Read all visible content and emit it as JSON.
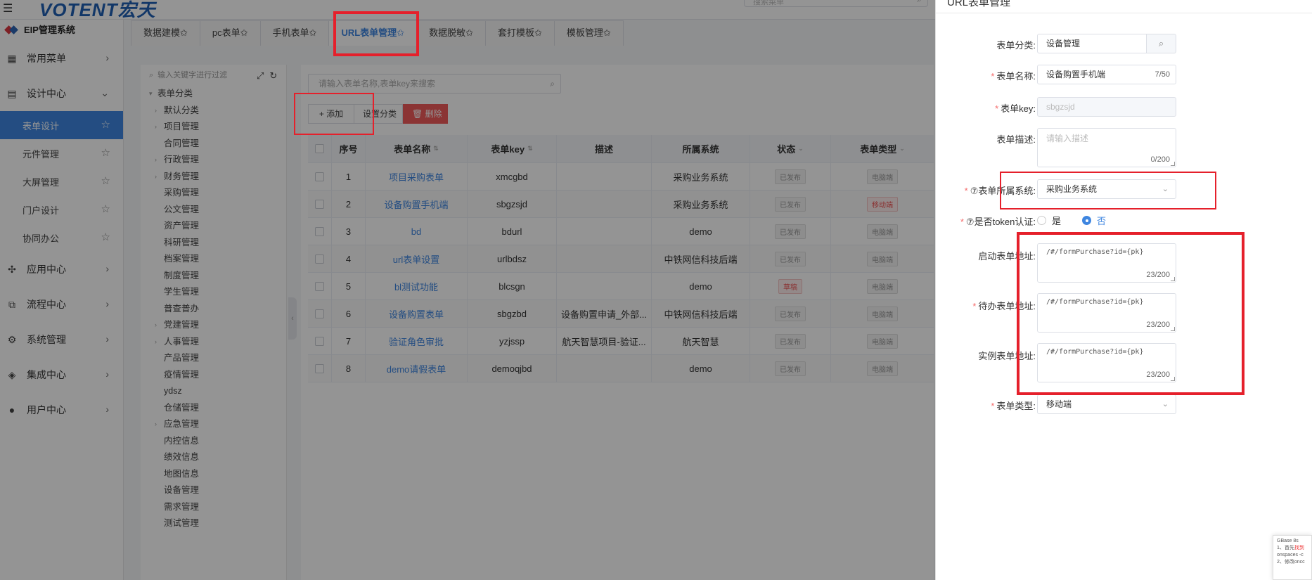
{
  "topbar": {
    "brand": "VOTENT宏天",
    "search_placeholder": "搜索菜单"
  },
  "sidebar": {
    "system_name": "EIP管理系统",
    "groups": [
      {
        "label": "常用菜单",
        "icon": "grid-icon"
      },
      {
        "label": "设计中心",
        "icon": "design-icon",
        "expanded": true,
        "items": [
          "表单设计",
          "元件管理",
          "大屏管理",
          "门户设计",
          "协同办公"
        ]
      },
      {
        "label": "应用中心",
        "icon": "apps-icon"
      },
      {
        "label": "流程中心",
        "icon": "flow-icon"
      },
      {
        "label": "系统管理",
        "icon": "gear-icon"
      },
      {
        "label": "集成中心",
        "icon": "layers-icon"
      },
      {
        "label": "用户中心",
        "icon": "user-icon"
      }
    ]
  },
  "tabs": [
    "数据建模✩",
    "pc表单✩",
    "手机表单✩",
    "URL表单管理✩",
    "数据脱敏✩",
    "套打模板✩",
    "模板管理✩"
  ],
  "tree": {
    "search_placeholder": "输入关键字进行过滤",
    "root": "表单分类",
    "children": [
      {
        "label": "默认分类",
        "expandable": true
      },
      {
        "label": "项目管理",
        "expandable": true
      },
      {
        "label": "合同管理",
        "expandable": false
      },
      {
        "label": "行政管理",
        "expandable": true
      },
      {
        "label": "财务管理",
        "expandable": true
      },
      {
        "label": "采购管理",
        "expandable": false
      },
      {
        "label": "公文管理",
        "expandable": false
      },
      {
        "label": "资产管理",
        "expandable": false
      },
      {
        "label": "科研管理",
        "expandable": false
      },
      {
        "label": "档案管理",
        "expandable": false
      },
      {
        "label": "制度管理",
        "expandable": false
      },
      {
        "label": "学生管理",
        "expandable": false
      },
      {
        "label": "普查普办",
        "expandable": false
      },
      {
        "label": "党建管理",
        "expandable": true
      },
      {
        "label": "人事管理",
        "expandable": true
      },
      {
        "label": "产品管理",
        "expandable": false
      },
      {
        "label": "疫情管理",
        "expandable": false
      },
      {
        "label": "ydsz",
        "expandable": false
      },
      {
        "label": "仓储管理",
        "expandable": false
      },
      {
        "label": "应急管理",
        "expandable": true
      },
      {
        "label": "内控信息",
        "expandable": false
      },
      {
        "label": "绩效信息",
        "expandable": false
      },
      {
        "label": "地图信息",
        "expandable": false
      },
      {
        "label": "设备管理",
        "expandable": false
      },
      {
        "label": "需求管理",
        "expandable": false
      },
      {
        "label": "测试管理",
        "expandable": false
      }
    ]
  },
  "main": {
    "search_placeholder": "请输入表单名称,表单key来搜索",
    "buttons": {
      "add": "+ 添加",
      "category": "设置分类",
      "delete": "删除"
    },
    "columns": [
      "序号",
      "表单名称",
      "表单key",
      "描述",
      "所属系统",
      "状态",
      "表单类型"
    ],
    "rows": [
      {
        "no": "1",
        "name": "项目采购表单",
        "key": "xmcgbd",
        "desc": "",
        "system": "采购业务系统",
        "status": "已发布",
        "type": "电脑端"
      },
      {
        "no": "2",
        "name": "设备购置手机端",
        "key": "sbgzsjd",
        "desc": "",
        "system": "采购业务系统",
        "status": "已发布",
        "type": "移动端"
      },
      {
        "no": "3",
        "name": "bd",
        "key": "bdurl",
        "desc": "",
        "system": "demo",
        "status": "已发布",
        "type": "电脑端"
      },
      {
        "no": "4",
        "name": "url表单设置",
        "key": "urlbdsz",
        "desc": "",
        "system": "中铁网信科技后端",
        "status": "已发布",
        "type": "电脑端"
      },
      {
        "no": "5",
        "name": "bl测试功能",
        "key": "blcsgn",
        "desc": "",
        "system": "demo",
        "status": "草稿",
        "type": "电脑端"
      },
      {
        "no": "6",
        "name": "设备购置表单",
        "key": "sbgzbd",
        "desc": "设备购置申请_外部...",
        "system": "中铁网信科技后端",
        "status": "已发布",
        "type": "电脑端"
      },
      {
        "no": "7",
        "name": "验证角色审批",
        "key": "yzjssp",
        "desc": "航天智慧项目-验证...",
        "system": "航天智慧",
        "status": "已发布",
        "type": "电脑端"
      },
      {
        "no": "8",
        "name": "demo请假表单",
        "key": "demoqjbd",
        "desc": "",
        "system": "demo",
        "status": "已发布",
        "type": "电脑端"
      }
    ]
  },
  "drawer": {
    "title": "URL表单管理",
    "fields": {
      "category": {
        "label": "表单分类:",
        "value": "设备管理"
      },
      "name": {
        "label": "表单名称:",
        "value": "设备购置手机端",
        "count": "7/50",
        "required": true
      },
      "key": {
        "label": "表单key:",
        "value": "sbgzsjd",
        "required": true
      },
      "desc": {
        "label": "表单描述:",
        "placeholder": "请输入描述",
        "count": "0/200"
      },
      "system": {
        "label": "⑦表单所属系统:",
        "value": "采购业务系统",
        "required": true
      },
      "token": {
        "label": "⑦是否token认证:",
        "yes": "是",
        "no": "否",
        "selected": "否",
        "required": true
      },
      "start_url": {
        "label": "启动表单地址:",
        "value": "/#/formPurchase?id={pk}",
        "count": "23/200"
      },
      "todo_url": {
        "label": "待办表单地址:",
        "value": "/#/formPurchase?id={pk}",
        "count": "23/200",
        "required": true
      },
      "instance_url": {
        "label": "实例表单地址:",
        "value": "/#/formPurchase?id={pk}",
        "count": "23/200"
      },
      "form_type": {
        "label": "表单类型:",
        "value": "移动端",
        "required": true
      }
    }
  },
  "popup": {
    "line1": "GBase 8s",
    "line2_a": "1、首先",
    "line2_b": "找到",
    "line3": "onspaces -c",
    "line4": "2、修改oncc"
  },
  "colors": {
    "accent": "#3f86e0",
    "annotation_red": "#e5202b",
    "delete_red": "#f05b5b",
    "required": "#f56c6c"
  }
}
